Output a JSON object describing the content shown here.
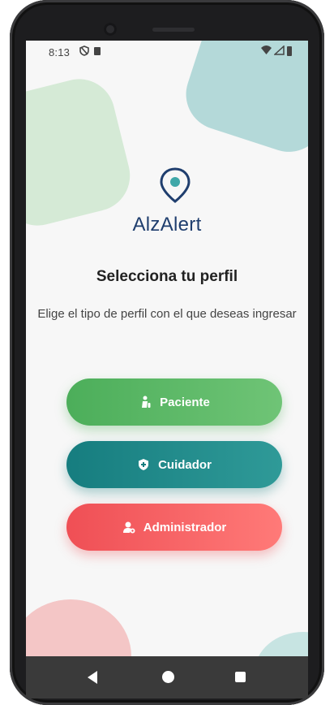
{
  "status_bar": {
    "time": "8:13",
    "icons": [
      "shield-icon",
      "sim-icon",
      "wifi-icon",
      "signal-icon",
      "battery-icon"
    ]
  },
  "app": {
    "name": "AlzAlert",
    "logo_icon": "location-pin-icon"
  },
  "screen": {
    "title": "Selecciona tu perfil",
    "subtitle": "Elige el tipo de perfil con el que deseas ingresar"
  },
  "buttons": [
    {
      "label": "Paciente",
      "icon": "person-icon",
      "color": "#4cae5a"
    },
    {
      "label": "Cuidador",
      "icon": "shield-plus-icon",
      "color": "#167d7f"
    },
    {
      "label": "Administrador",
      "icon": "admin-icon",
      "color": "#ef4f55"
    }
  ],
  "nav_bar": {
    "buttons": [
      "back-icon",
      "home-icon",
      "recents-icon"
    ]
  },
  "colors": {
    "brand": "#1f3e6e",
    "accent_teal": "#3fa7a8",
    "background": "#f7f7f7"
  }
}
